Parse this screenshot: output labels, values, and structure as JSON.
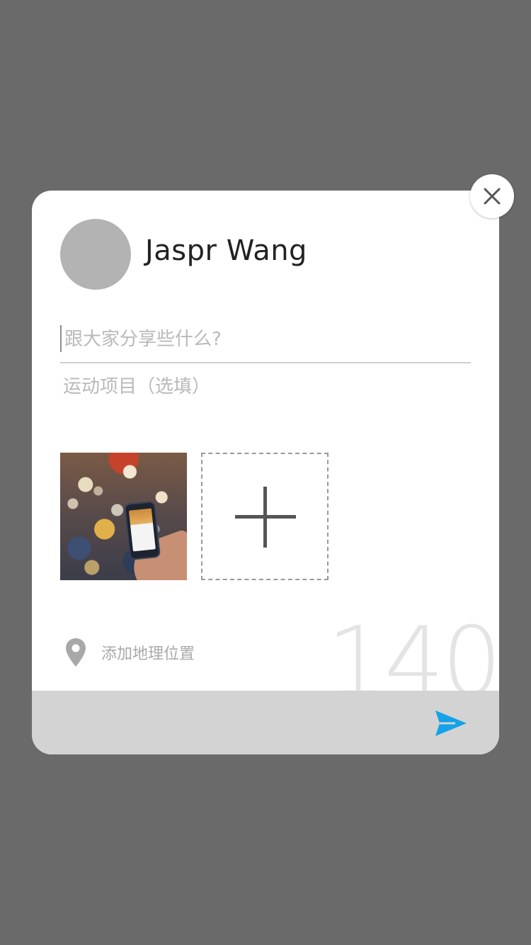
{
  "user": {
    "name": "Jaspr Wang"
  },
  "post": {
    "placeholder": "跟大家分享些什么?",
    "value": ""
  },
  "sport": {
    "placeholder": "运动项目（选填）",
    "value": ""
  },
  "location": {
    "label": "添加地理位置",
    "icon": "location-pin-icon"
  },
  "char_counter": "140",
  "colors": {
    "overlay": "#6a6a6a",
    "card": "#ffffff",
    "avatar_placeholder": "#b3b3b3",
    "bottom_bar": "#d3d3d3",
    "send_accent": "#14a2e8",
    "muted_text": "#b9b9b9"
  },
  "icons": {
    "close": "close-icon",
    "add_photo": "plus-icon",
    "send": "send-icon"
  }
}
